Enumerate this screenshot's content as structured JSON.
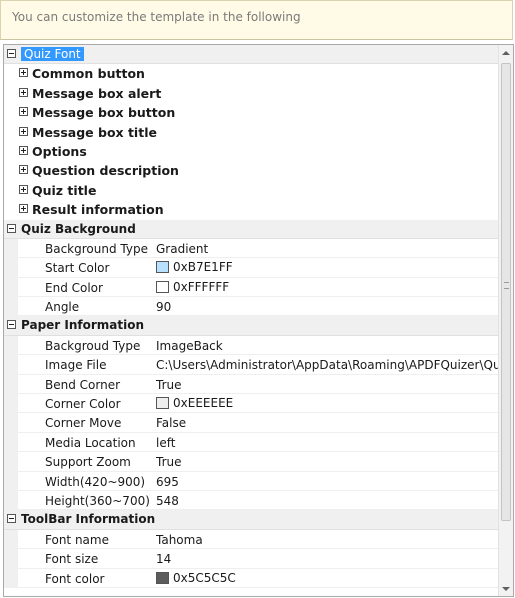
{
  "banner": {
    "text": "You can customize the  template in the following"
  },
  "grid": {
    "categories": {
      "quiz_font": {
        "label": "Quiz Font",
        "children": [
          "Common button",
          "Message box alert",
          "Message box button",
          "Message box title",
          "Options",
          "Question description",
          "Quiz title",
          "Result information"
        ]
      },
      "quiz_background": {
        "label": "Quiz Background",
        "props": [
          {
            "name": "Background Type",
            "value": "Gradient"
          },
          {
            "name": "Start Color",
            "value": "0xB7E1FF",
            "swatch": "#B7E1FF"
          },
          {
            "name": "End Color",
            "value": "0xFFFFFF",
            "swatch": "#FFFFFF"
          },
          {
            "name": "Angle",
            "value": "90"
          }
        ]
      },
      "paper_information": {
        "label": "Paper Information",
        "props": [
          {
            "name": "Backgroud Type",
            "value": "ImageBack"
          },
          {
            "name": "Image File",
            "value": "C:\\Users\\Administrator\\AppData\\Roaming\\APDFQuizer\\Qui"
          },
          {
            "name": "Bend Corner",
            "value": "True"
          },
          {
            "name": "Corner Color",
            "value": "0xEEEEEE",
            "swatch": "#EEEEEE"
          },
          {
            "name": "Corner Move",
            "value": "False"
          },
          {
            "name": "Media Location",
            "value": "left"
          },
          {
            "name": "Support Zoom",
            "value": "True"
          },
          {
            "name": "Width(420~900)",
            "value": "695"
          },
          {
            "name": "Height(360~700)",
            "value": "548"
          }
        ]
      },
      "toolbar_information": {
        "label": "ToolBar Information",
        "props": [
          {
            "name": "Font name",
            "value": "Tahoma"
          },
          {
            "name": "Font size",
            "value": "14"
          },
          {
            "name": "Font color",
            "value": "0x5C5C5C",
            "swatch": "#5C5C5C"
          }
        ]
      }
    }
  },
  "colors": {
    "selection": "#3399ff",
    "banner_bg": "#fffbe6",
    "category_bg": "#f0f0f0"
  },
  "icons": {
    "collapse": "minus-box-icon",
    "expand": "plus-box-icon",
    "scroll_up": "scroll-up-arrow-icon",
    "scroll_down": "scroll-down-arrow-icon"
  }
}
